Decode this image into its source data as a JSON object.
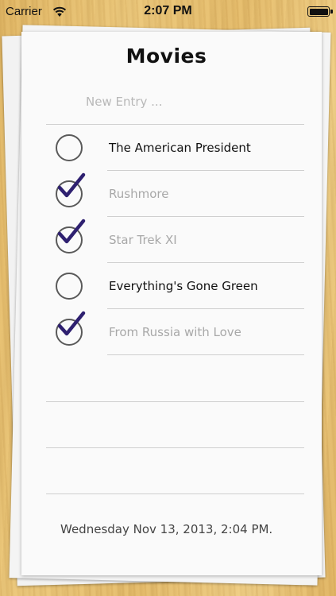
{
  "status_bar": {
    "carrier": "Carrier",
    "time": "2:07 PM",
    "wifi_icon": "wifi-icon",
    "battery_icon": "battery-full-icon"
  },
  "list": {
    "title": "Movies",
    "new_entry_placeholder": "New Entry ...",
    "new_entry_value": "",
    "items": [
      {
        "label": "The American President",
        "checked": false
      },
      {
        "label": "Rushmore",
        "checked": true
      },
      {
        "label": "Star Trek XI",
        "checked": true
      },
      {
        "label": "Everything's Gone Green",
        "checked": false
      },
      {
        "label": "From Russia with Love",
        "checked": true
      }
    ],
    "footer_date": "Wednesday Nov 13, 2013, 2:04 PM."
  },
  "colors": {
    "checkmark": "#2e2070",
    "unchecked_text": "#111111",
    "checked_text": "#a8a8a8",
    "wood": "#e9c274"
  }
}
